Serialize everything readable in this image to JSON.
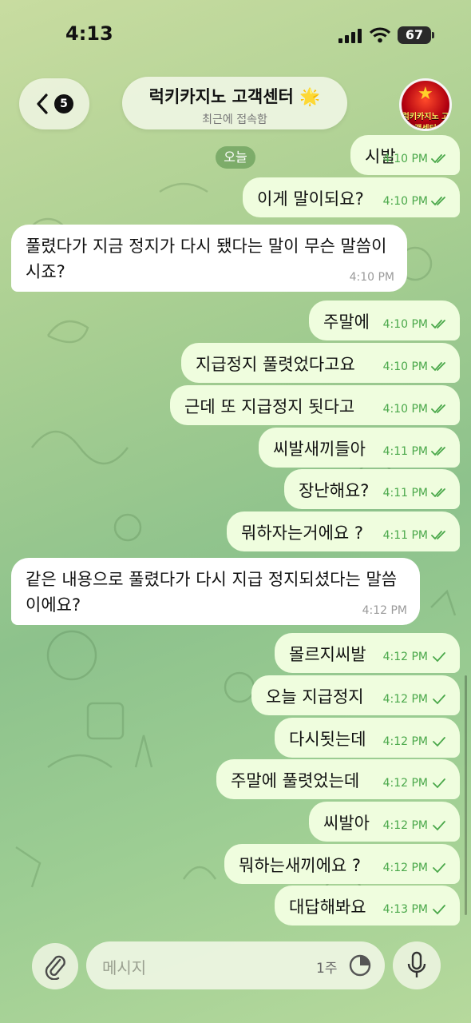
{
  "status_bar": {
    "time": "4:13",
    "battery": "67"
  },
  "header": {
    "back_count": "5",
    "title": "럭키카지노 고객센터 🌟",
    "subtitle": "최근에 접속함",
    "avatar_text": "럭키카지노 고객센터"
  },
  "date_chip": "오늘",
  "messages": [
    {
      "dir": "out",
      "text": "시발",
      "time": "4:10 PM",
      "read": true
    },
    {
      "dir": "out",
      "text": "이게 말이되요?",
      "time": "4:10 PM",
      "read": true
    },
    {
      "dir": "in",
      "text": "풀렸다가 지금 정지가 다시 됐다는 말이 무슨 말씀이시죠?",
      "time": "4:10 PM"
    },
    {
      "dir": "out",
      "text": "주말에",
      "time": "4:10 PM",
      "read": true
    },
    {
      "dir": "out",
      "text": "지급정지 풀렷었다고요",
      "time": "4:10 PM",
      "read": true
    },
    {
      "dir": "out",
      "text": "근데 또 지급정지 됫다고",
      "time": "4:10 PM",
      "read": true
    },
    {
      "dir": "out",
      "text": "씨발새끼들아",
      "time": "4:11 PM",
      "read": true
    },
    {
      "dir": "out",
      "text": "장난해요?",
      "time": "4:11 PM",
      "read": true
    },
    {
      "dir": "out",
      "text": "뭐하자는거에요 ?",
      "time": "4:11 PM",
      "read": true
    },
    {
      "dir": "in",
      "text": "같은 내용으로 풀렸다가 다시 지급 정지되셨다는 말씀이에요?",
      "time": "4:12 PM"
    },
    {
      "dir": "out",
      "text": "몰르지씨발",
      "time": "4:12 PM",
      "read": false
    },
    {
      "dir": "out",
      "text": "오늘 지급정지",
      "time": "4:12 PM",
      "read": false
    },
    {
      "dir": "out",
      "text": "다시됫는데",
      "time": "4:12 PM",
      "read": false
    },
    {
      "dir": "out",
      "text": "주말에 풀렷었는데",
      "time": "4:12 PM",
      "read": false
    },
    {
      "dir": "out",
      "text": "씨발아",
      "time": "4:12 PM",
      "read": false
    },
    {
      "dir": "out",
      "text": "뭐하는새끼에요 ?",
      "time": "4:12 PM",
      "read": false
    },
    {
      "dir": "out",
      "text": "대답해봐요",
      "time": "4:13 PM",
      "read": false
    }
  ],
  "composer": {
    "placeholder": "메시지",
    "timer_label": "1주"
  },
  "icons": {
    "back": "chevron-left-icon",
    "attach": "paperclip-icon",
    "timer": "timer-icon",
    "mic": "microphone-icon",
    "read_check": "double-check-icon",
    "sent_check": "single-check-icon"
  },
  "colors": {
    "outgoing_bubble": "#effdde",
    "incoming_bubble": "#ffffff",
    "check": "#4aa84a"
  }
}
